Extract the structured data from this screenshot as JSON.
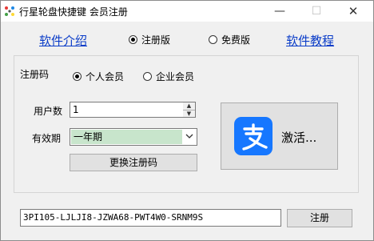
{
  "window": {
    "title": "行星轮盘快捷键 会员注册",
    "min_glyph": "—",
    "max_glyph": "☐",
    "close_glyph": "✕"
  },
  "nav": {
    "software_intro": "软件介绍",
    "software_tutorial": "软件教程",
    "edition_registered": "注册版",
    "edition_free": "免费版",
    "selected_edition": "注册版"
  },
  "register_group": {
    "legend": "注册码",
    "member_personal": "个人会员",
    "member_enterprise": "企业会员",
    "selected_member_type": "个人会员",
    "user_count_label": "用户数",
    "user_count_value": "1",
    "validity_label": "有效期",
    "validity_value": "一年期",
    "change_code_button": "更换注册码",
    "activate_button": "激活...",
    "activate_icon": "alipay-icon",
    "activate_icon_color": "#1677ff"
  },
  "footer": {
    "registration_code": "3PI105-LJLJI8-JZWA68-PWT4W0-SRNM9S",
    "register_button": "注册"
  }
}
